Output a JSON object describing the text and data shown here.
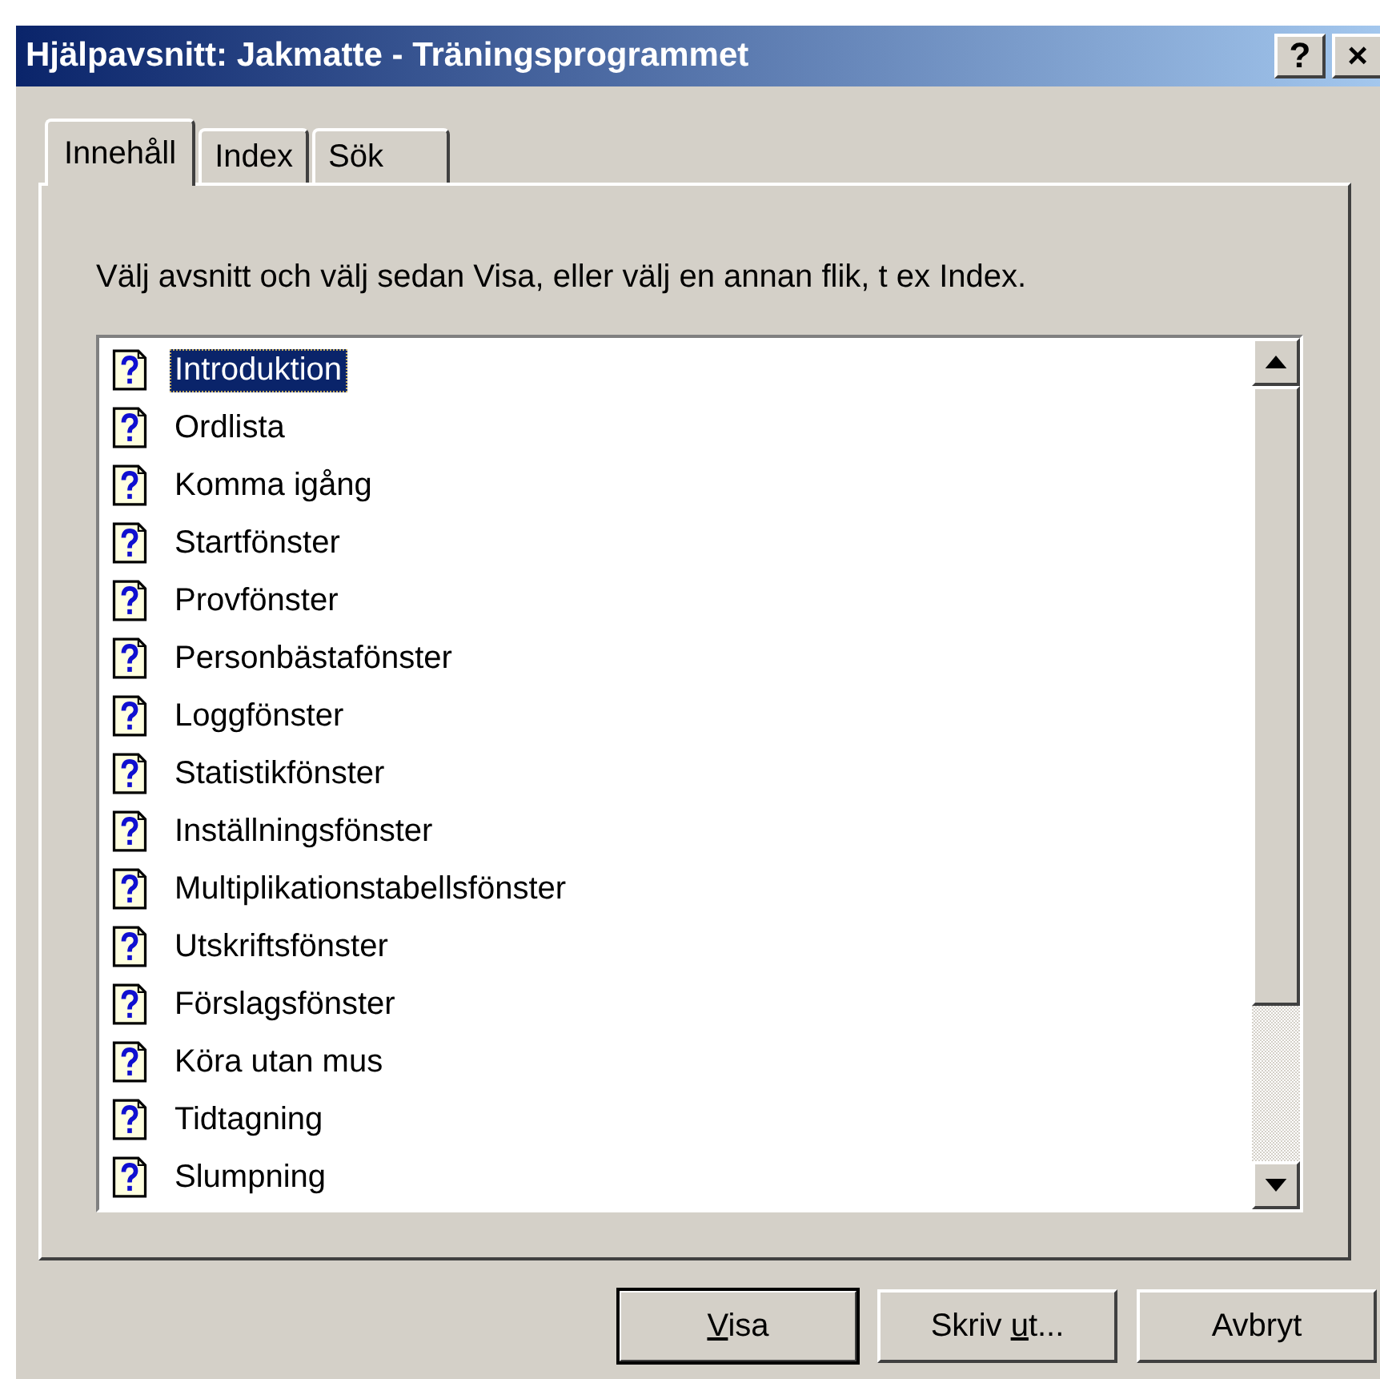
{
  "window": {
    "title": "Hjälpavsnitt: Jakmatte - Träningsprogrammet",
    "title_buttons": [
      "?",
      "×"
    ]
  },
  "tabs": [
    {
      "label": "Innehåll",
      "selected": true
    },
    {
      "label": "Index",
      "selected": false
    },
    {
      "label": "Sök",
      "selected": false
    }
  ],
  "instruction": "Välj avsnitt och välj sedan Visa, eller välj en annan flik, t ex Index.",
  "topics": [
    {
      "label": "Introduktion",
      "selected": true
    },
    {
      "label": "Ordlista",
      "selected": false
    },
    {
      "label": "Komma igång",
      "selected": false
    },
    {
      "label": "Startfönster",
      "selected": false
    },
    {
      "label": "Provfönster",
      "selected": false
    },
    {
      "label": "Personbästafönster",
      "selected": false
    },
    {
      "label": "Loggfönster",
      "selected": false
    },
    {
      "label": "Statistikfönster",
      "selected": false
    },
    {
      "label": "Inställningsfönster",
      "selected": false
    },
    {
      "label": "Multiplikationstabellsfönster",
      "selected": false
    },
    {
      "label": "Utskriftsfönster",
      "selected": false
    },
    {
      "label": "Förslagsfönster",
      "selected": false
    },
    {
      "label": "Köra utan mus",
      "selected": false
    },
    {
      "label": "Tidtagning",
      "selected": false
    },
    {
      "label": "Slumpning",
      "selected": false
    }
  ],
  "buttons": [
    {
      "label_parts": [
        {
          "text": "V",
          "underlined": true
        },
        {
          "text": "isa",
          "underlined": false
        }
      ],
      "default": true
    },
    {
      "label_parts": [
        {
          "text": "Skriv ",
          "underlined": false
        },
        {
          "text": "u",
          "underlined": true
        },
        {
          "text": "t...",
          "underlined": false
        }
      ],
      "default": false
    },
    {
      "label_parts": [
        {
          "text": "Avbryt",
          "underlined": false
        }
      ],
      "default": false
    }
  ]
}
